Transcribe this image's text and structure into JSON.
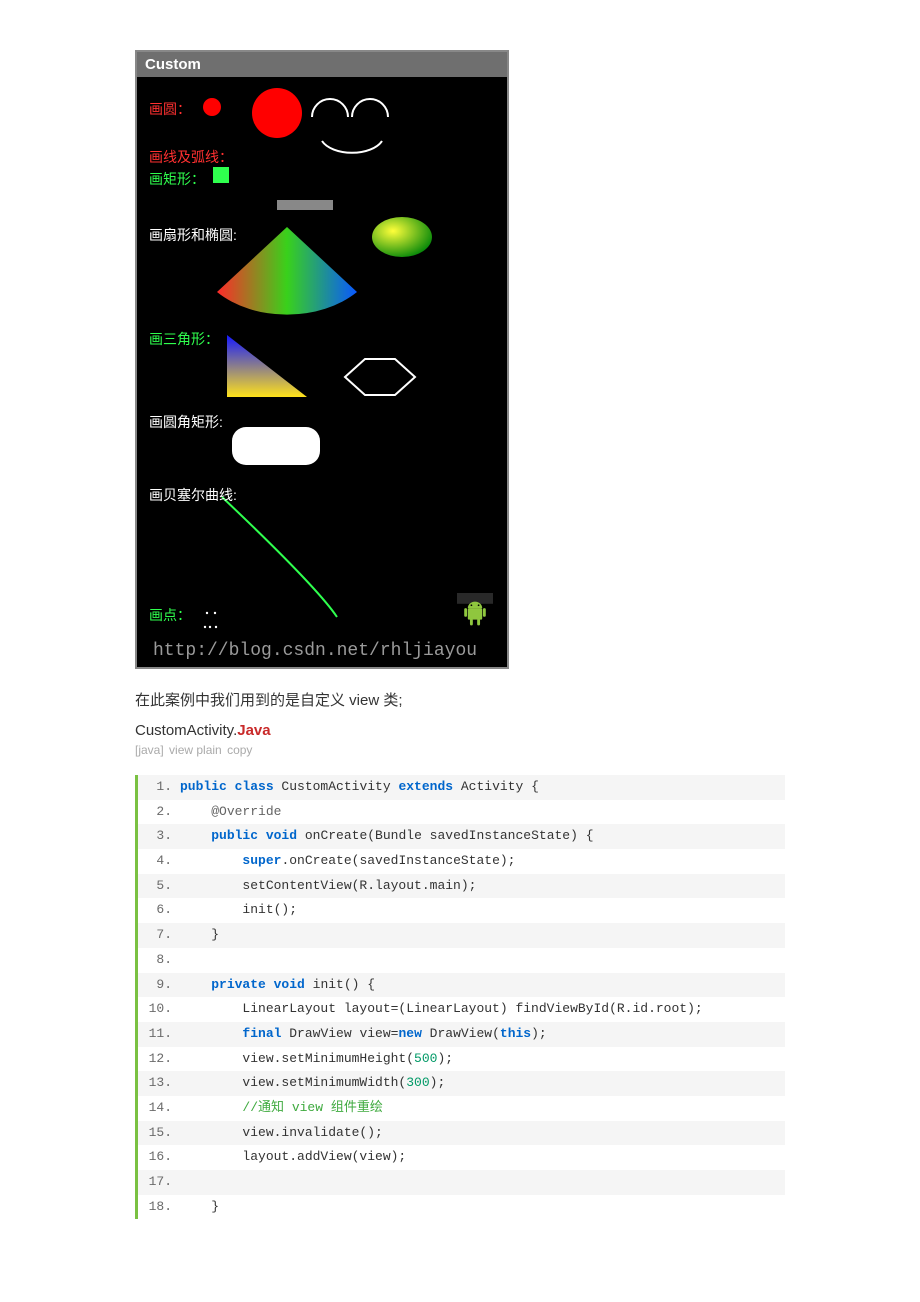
{
  "screenshot": {
    "title": "Custom",
    "labels": {
      "circle": "画圆：",
      "line_arc": "画线及弧线：",
      "rect": "画矩形：",
      "fan_oval": "画扇形和椭圆:",
      "triangle": "画三角形：",
      "roundrect": "画圆角矩形:",
      "bezier": "画贝塞尔曲线:",
      "point": "画点："
    },
    "watermark": "http://blog.csdn.net/rhljiayou"
  },
  "description": "在此案例中我们用到的是自定义 view 类;",
  "filename_prefix": "CustomActivity.",
  "filename_lang": "Java",
  "toolbar": {
    "tag": "[java]",
    "view": "view plain",
    "copy": "copy"
  },
  "code": [
    {
      "n": "1.",
      "hl": true,
      "segs": [
        [
          "",
          "plain"
        ],
        [
          "public class",
          "kw"
        ],
        [
          " CustomActivity ",
          "plain"
        ],
        [
          "extends",
          "kw"
        ],
        [
          " Activity {  ",
          "plain"
        ]
      ]
    },
    {
      "n": "2.",
      "hl": false,
      "segs": [
        [
          "    ",
          "plain"
        ],
        [
          "@Override",
          "anno"
        ],
        [
          "  ",
          "plain"
        ]
      ]
    },
    {
      "n": "3.",
      "hl": true,
      "segs": [
        [
          "    ",
          "plain"
        ],
        [
          "public void",
          "kw"
        ],
        [
          " onCreate(Bundle savedInstanceState) {  ",
          "plain"
        ]
      ]
    },
    {
      "n": "4.",
      "hl": false,
      "segs": [
        [
          "        ",
          "plain"
        ],
        [
          "super",
          "kw"
        ],
        [
          ".onCreate(savedInstanceState);  ",
          "plain"
        ]
      ]
    },
    {
      "n": "5.",
      "hl": true,
      "segs": [
        [
          "        setContentView(R.layout.main);  ",
          "plain"
        ]
      ]
    },
    {
      "n": "6.",
      "hl": false,
      "segs": [
        [
          "        init();  ",
          "plain"
        ]
      ]
    },
    {
      "n": "7.",
      "hl": true,
      "segs": [
        [
          "    }  ",
          "plain"
        ]
      ]
    },
    {
      "n": "8.",
      "hl": false,
      "segs": [
        [
          "  ",
          "plain"
        ]
      ]
    },
    {
      "n": "9.",
      "hl": true,
      "segs": [
        [
          "    ",
          "plain"
        ],
        [
          "private void",
          "kw"
        ],
        [
          " init() {  ",
          "plain"
        ]
      ]
    },
    {
      "n": "10.",
      "hl": false,
      "segs": [
        [
          "        LinearLayout layout=(LinearLayout) findViewById(R.id.root);  ",
          "plain"
        ]
      ]
    },
    {
      "n": "11.",
      "hl": true,
      "segs": [
        [
          "        ",
          "plain"
        ],
        [
          "final",
          "kw"
        ],
        [
          " DrawView view=",
          "plain"
        ],
        [
          "new",
          "kw"
        ],
        [
          " DrawView(",
          "plain"
        ],
        [
          "this",
          "str-this"
        ],
        [
          ");  ",
          "plain"
        ]
      ]
    },
    {
      "n": "12.",
      "hl": false,
      "segs": [
        [
          "        view.setMinimumHeight(",
          "plain"
        ],
        [
          "500",
          "num"
        ],
        [
          ");  ",
          "plain"
        ]
      ]
    },
    {
      "n": "13.",
      "hl": true,
      "segs": [
        [
          "        view.setMinimumWidth(",
          "plain"
        ],
        [
          "300",
          "num"
        ],
        [
          ");  ",
          "plain"
        ]
      ]
    },
    {
      "n": "14.",
      "hl": false,
      "segs": [
        [
          "        ",
          "plain"
        ],
        [
          "//通知 view 组件重绘  ",
          "comment"
        ]
      ]
    },
    {
      "n": "15.",
      "hl": true,
      "segs": [
        [
          "        view.invalidate();  ",
          "plain"
        ]
      ]
    },
    {
      "n": "16.",
      "hl": false,
      "segs": [
        [
          "        layout.addView(view);  ",
          "plain"
        ]
      ]
    },
    {
      "n": "17.",
      "hl": true,
      "segs": [
        [
          "          ",
          "plain"
        ]
      ]
    },
    {
      "n": "18.",
      "hl": false,
      "segs": [
        [
          "    }  ",
          "plain"
        ]
      ]
    }
  ]
}
